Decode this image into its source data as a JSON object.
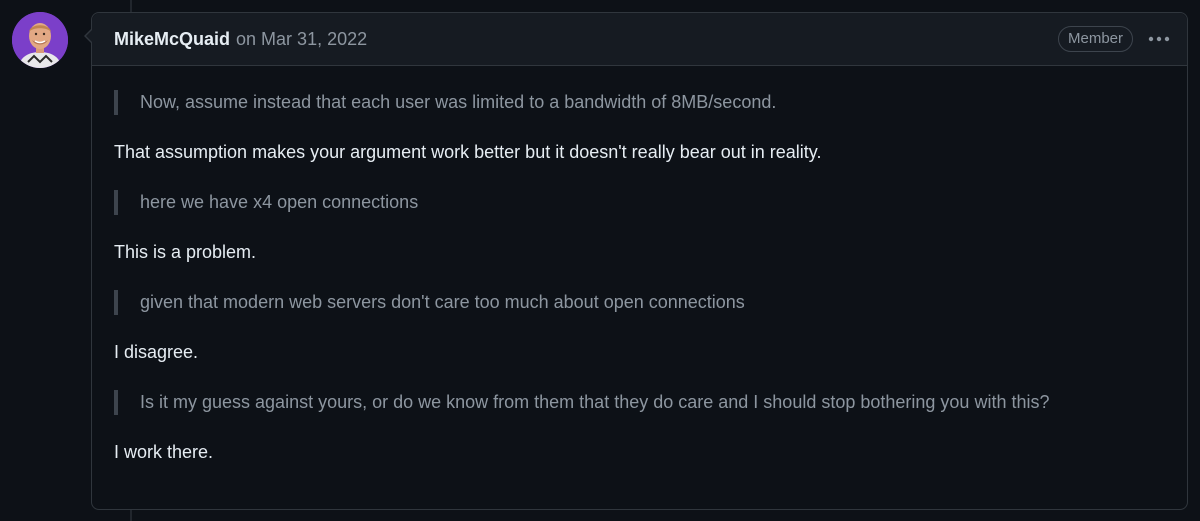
{
  "comment": {
    "author": "MikeMcQuaid",
    "timestamp": "on Mar 31, 2022",
    "badge": "Member",
    "options_icon": "kebab-horizontal-icon",
    "body": [
      {
        "type": "quote",
        "text": "Now, assume instead that each user was limited to a bandwidth of 8MB/second."
      },
      {
        "type": "paragraph",
        "text": "That assumption makes your argument work better but it doesn't really bear out in reality."
      },
      {
        "type": "quote",
        "text": "here we have x4 open connections"
      },
      {
        "type": "paragraph",
        "text": "This is a problem."
      },
      {
        "type": "quote",
        "text": "given that modern web servers don't care too much about open connections"
      },
      {
        "type": "paragraph",
        "text": "I disagree."
      },
      {
        "type": "quote",
        "text": "Is it my guess against yours, or do we know from them that they do care and I should stop bothering you with this?"
      },
      {
        "type": "paragraph",
        "text": "I work there."
      }
    ]
  },
  "colors": {
    "background": "#0d1117",
    "header_background": "#161b22",
    "border": "#30363d",
    "text_primary": "#e6edf3",
    "text_muted": "#8d96a0",
    "avatar_background": "#7b3fc9"
  }
}
